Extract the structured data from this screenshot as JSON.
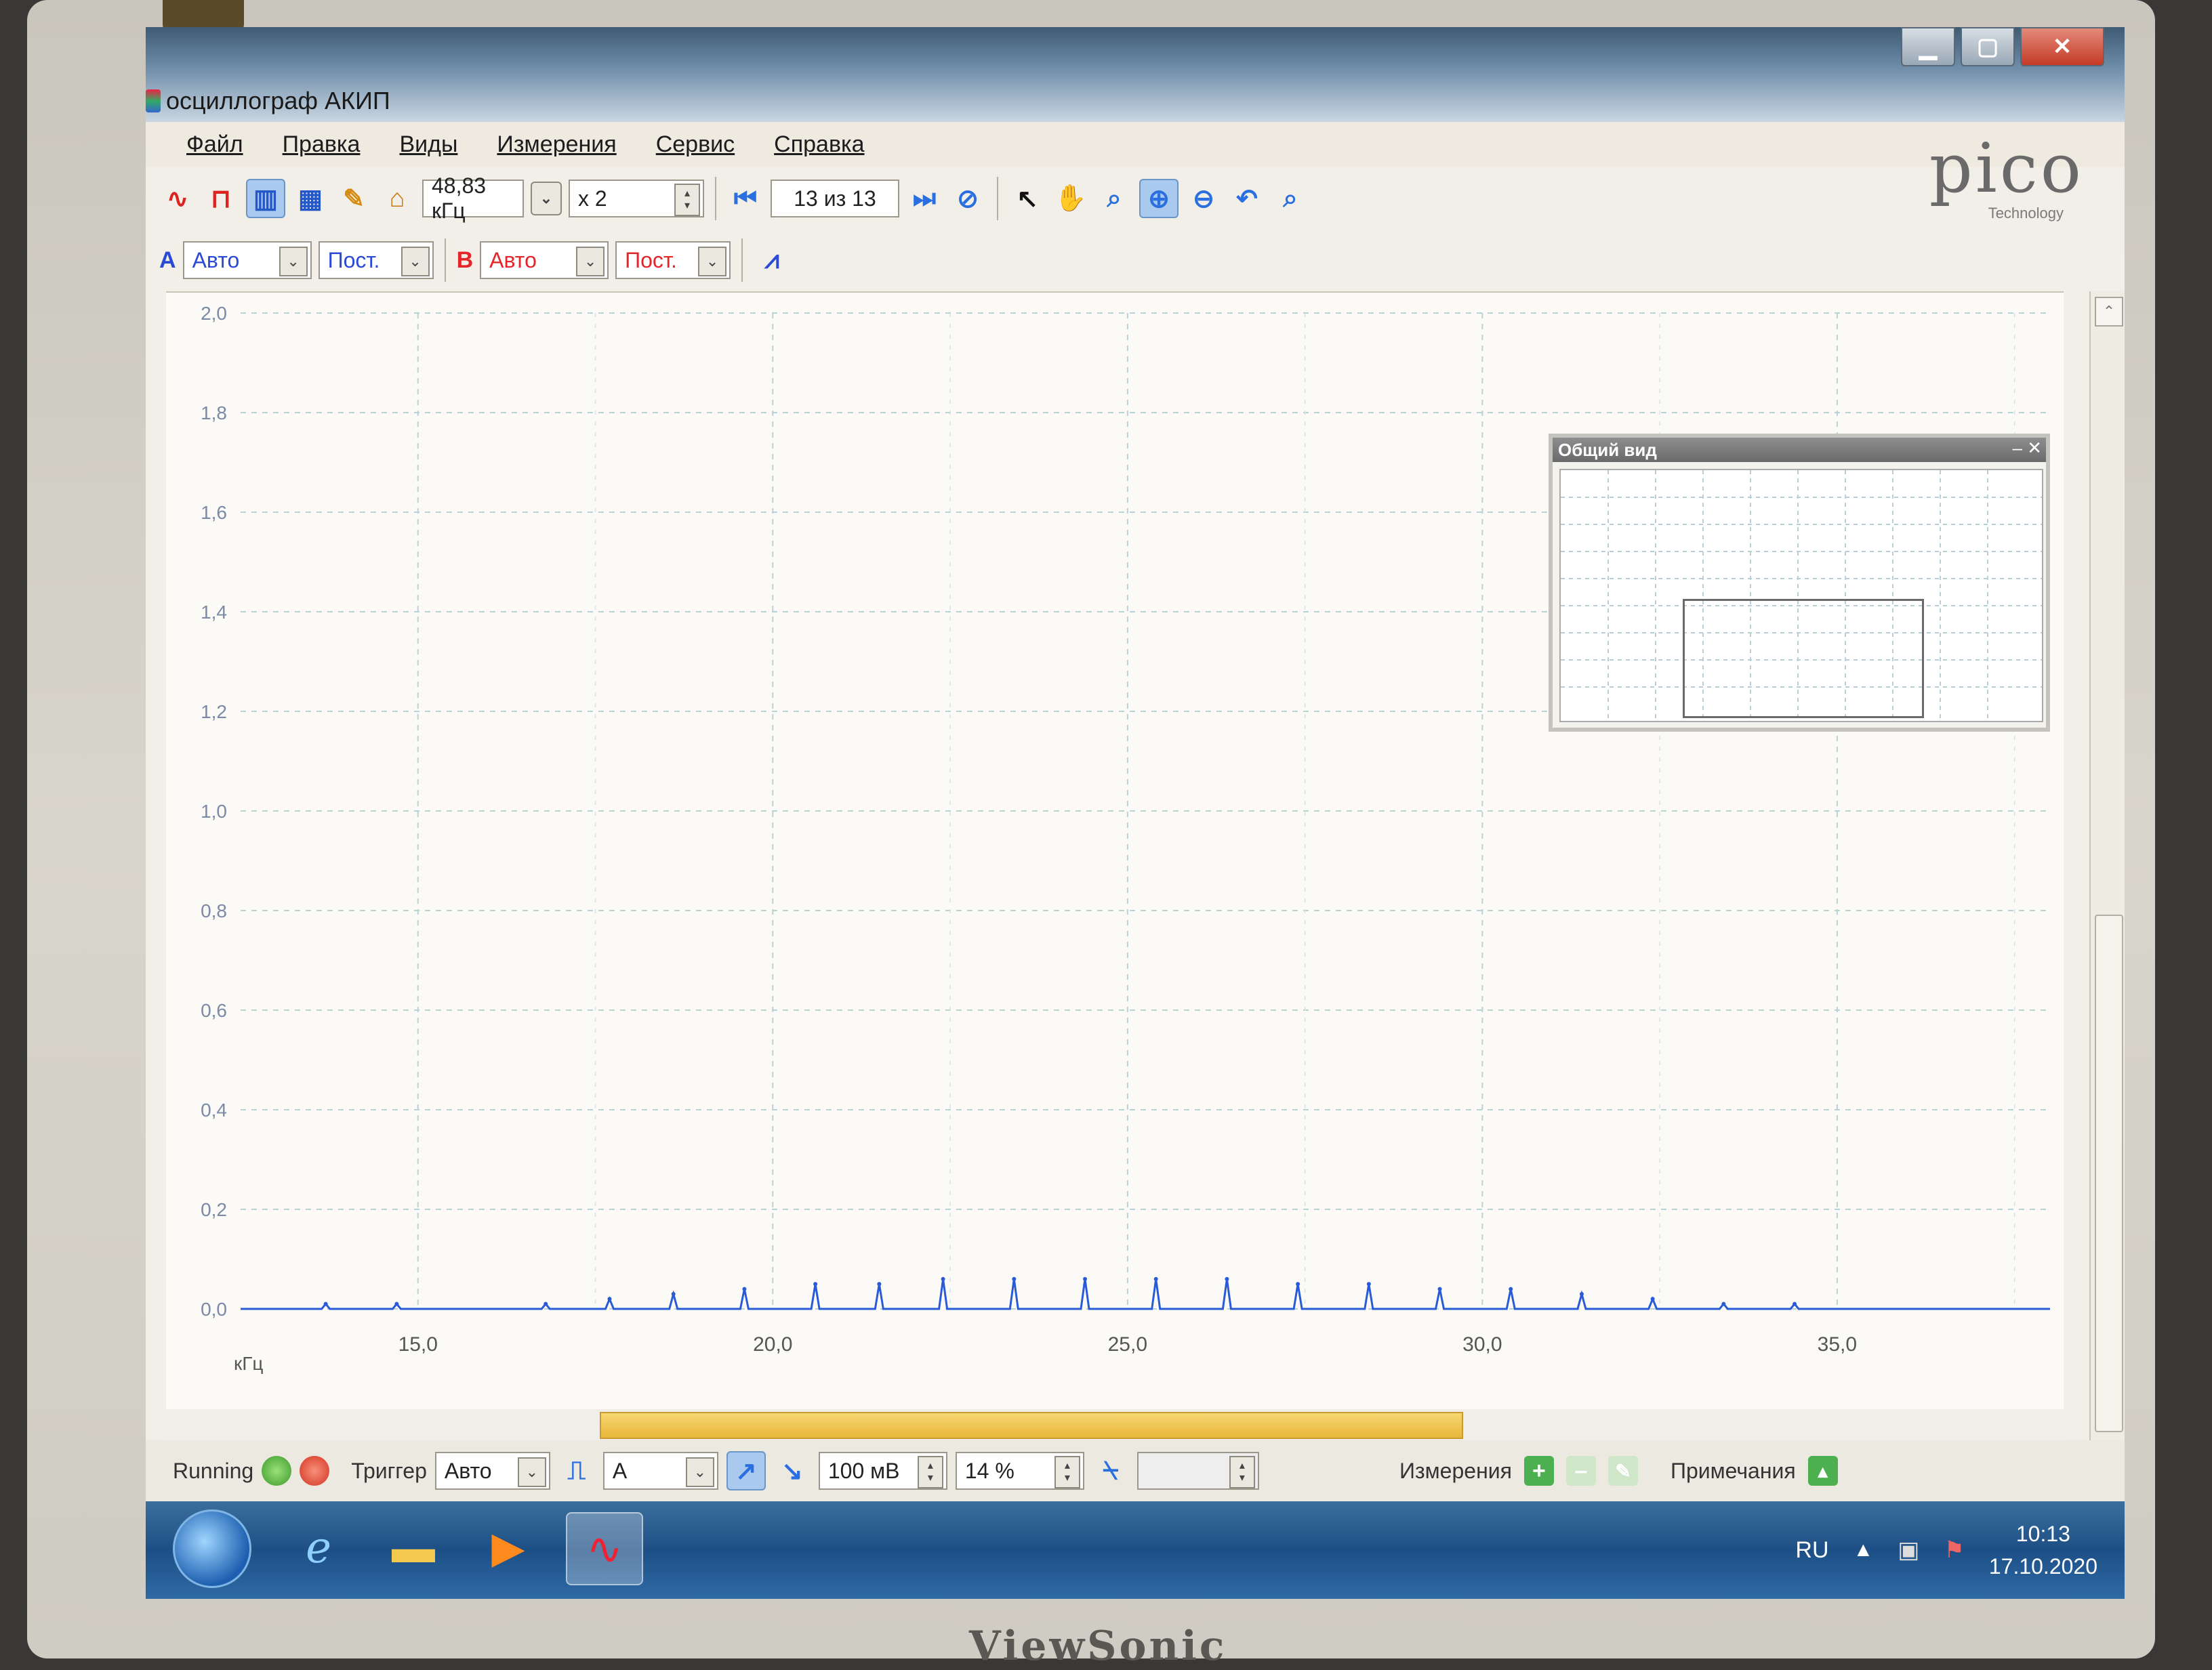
{
  "window": {
    "title": "осциллограф АКИП",
    "buttons": [
      "▁",
      "▢",
      "✕"
    ]
  },
  "menu": [
    "Файл",
    "Правка",
    "Виды",
    "Измерения",
    "Сервис",
    "Справка"
  ],
  "logo": {
    "text": "pico",
    "sub": "Technology"
  },
  "toolbar": {
    "sample_rate": "48,83 кГц",
    "multiplier": "x 2",
    "buffer_position": "13 из 13"
  },
  "channels": {
    "a_label": "A",
    "a_range": "Авто",
    "a_coupling": "Пост.",
    "b_label": "B",
    "b_range": "Авто",
    "b_coupling": "Пост."
  },
  "chart_data": {
    "type": "line",
    "xlabel": "кГц",
    "xlim": [
      12.5,
      38
    ],
    "ylim": [
      0,
      2.0
    ],
    "x_ticks": [
      "15,0",
      "20,0",
      "25,0",
      "30,0",
      "35,0"
    ],
    "y_ticks": [
      "2,0",
      "1,8",
      "1,6",
      "1,4",
      "1,2",
      "1,0",
      "0,8",
      "0,6",
      "0,4",
      "0,2",
      "0,0"
    ],
    "series": [
      {
        "x": [
          13.7,
          14.7,
          16.8,
          17.7,
          18.6,
          19.6,
          20.6,
          21.5,
          22.4,
          23.4,
          24.4,
          25.4,
          26.4,
          27.4,
          28.4,
          29.4,
          30.4,
          31.4,
          32.4,
          33.4,
          34.4
        ],
        "values": [
          0.01,
          0.01,
          0.01,
          0.02,
          0.03,
          0.04,
          0.05,
          0.05,
          0.06,
          0.06,
          0.06,
          0.06,
          0.06,
          0.05,
          0.05,
          0.04,
          0.04,
          0.03,
          0.02,
          0.01,
          0.01
        ]
      }
    ],
    "grid": true,
    "color": "#2a5bd6"
  },
  "overview": {
    "title": "Общий вид"
  },
  "status": {
    "running": "Running",
    "trigger_label": "Триггер",
    "trigger_mode": "Авто",
    "trigger_channel": "A",
    "trigger_level": "100 мВ",
    "pre_trigger": "14 %",
    "measurements": "Измерения",
    "notes": "Примечания"
  },
  "taskbar": {
    "lang": "RU",
    "time": "10:13",
    "date": "17.10.2020"
  }
}
